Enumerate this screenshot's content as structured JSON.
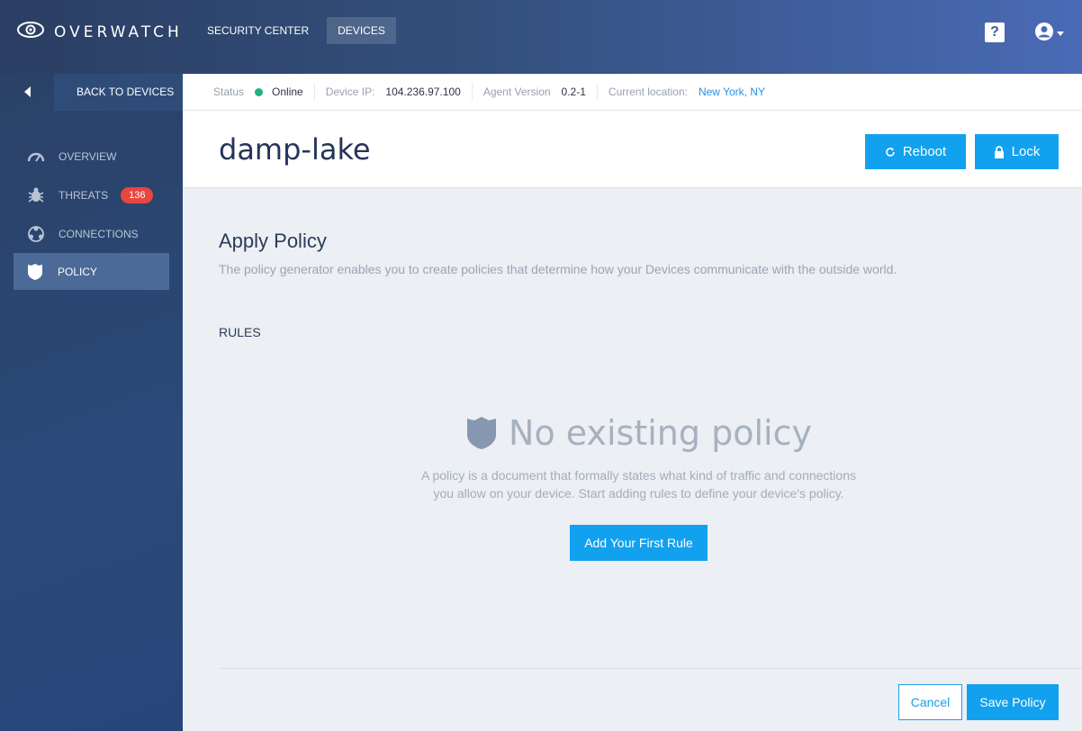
{
  "app": {
    "name": "OVERWATCH",
    "logo_icon": "eye-icon"
  },
  "topnav": {
    "items": [
      {
        "label": "SECURITY CENTER",
        "active": false
      },
      {
        "label": "DEVICES",
        "active": true
      }
    ],
    "help_label": "?"
  },
  "sidebar": {
    "back_label": "BACK TO DEVICES",
    "items": [
      {
        "label": "OVERVIEW",
        "icon": "gauge-icon"
      },
      {
        "label": "THREATS",
        "icon": "bug-icon",
        "badge": "136"
      },
      {
        "label": "CONNECTIONS",
        "icon": "network-icon"
      },
      {
        "label": "POLICY",
        "icon": "shield-icon",
        "active": true
      }
    ]
  },
  "infobar": {
    "status_label": "Status",
    "status_value": "Online",
    "ip_label": "Device IP:",
    "ip_value": "104.236.97.100",
    "agent_label": "Agent Version",
    "agent_value": "0.2-1",
    "location_label": "Current location:",
    "location_value": "New York, NY"
  },
  "header": {
    "device_name": "damp-lake",
    "reboot_label": "Reboot",
    "lock_label": "Lock"
  },
  "policy": {
    "title": "Apply Policy",
    "description": "The policy generator enables you to create policies that determine how your Devices communicate with the outside world.",
    "rules_label": "RULES",
    "empty_title": "No existing policy",
    "empty_desc_line1": "A policy is a document that formally states what kind of traffic and connections",
    "empty_desc_line2": "you allow on your device. Start adding rules to define your device's policy.",
    "add_rule_label": "Add Your First Rule",
    "cancel_label": "Cancel",
    "save_label": "Save Policy"
  },
  "colors": {
    "accent": "#12a1ee",
    "badge": "#e9463f",
    "online": "#1fb37e"
  }
}
